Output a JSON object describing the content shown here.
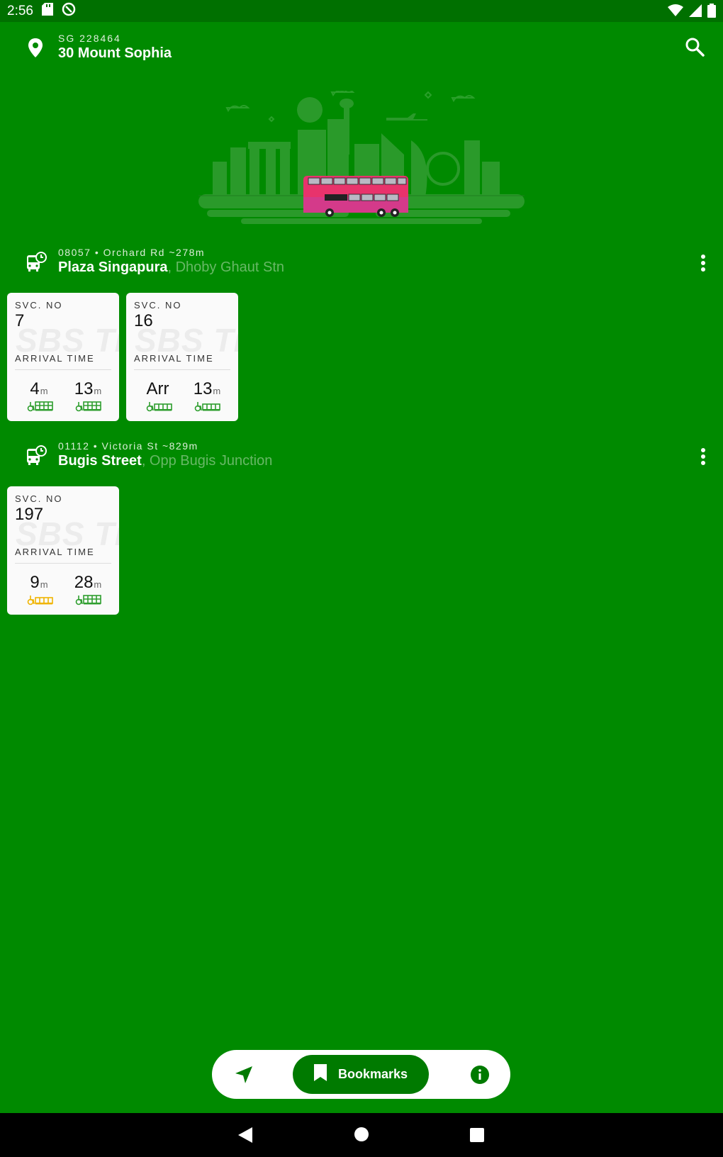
{
  "status": {
    "time": "2:56"
  },
  "header": {
    "postal": "SG 228464",
    "address": "30 Mount Sophia"
  },
  "stops": [
    {
      "meta": "08057 • Orchard Rd ~278m",
      "name": "Plaza Singapura",
      "road": ", Dhoby Ghaut Stn",
      "services": [
        {
          "svc_label": "SVC. NO",
          "svc": "7",
          "arr_label": "ARRIVAL TIME",
          "watermark": "SBS Tr",
          "eta1": "4",
          "eta1_unit": "m",
          "eta2": "13",
          "eta2_unit": "m"
        },
        {
          "svc_label": "SVC. NO",
          "svc": "16",
          "arr_label": "ARRIVAL TIME",
          "watermark": "SBS Tr",
          "eta1": "Arr",
          "eta1_unit": "",
          "eta2": "13",
          "eta2_unit": "m"
        }
      ]
    },
    {
      "meta": "01112 • Victoria St ~829m",
      "name": "Bugis Street",
      "road": ", Opp Bugis Junction",
      "services": [
        {
          "svc_label": "SVC. NO",
          "svc": "197",
          "arr_label": "ARRIVAL TIME",
          "watermark": "SBS Tr",
          "eta1": "9",
          "eta1_unit": "m",
          "eta2": "28",
          "eta2_unit": "m"
        }
      ]
    }
  ],
  "nav": {
    "bookmarks_label": "Bookmarks"
  },
  "colors": {
    "bg": "#008a00",
    "load_green": "#2e9e2e",
    "load_amber": "#f0b400"
  }
}
